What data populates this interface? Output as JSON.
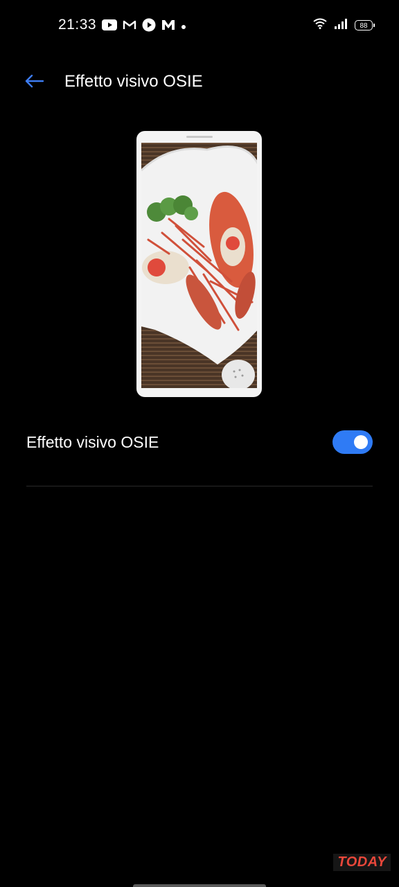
{
  "status_bar": {
    "time": "21:33",
    "battery": "88",
    "notification_icons": [
      "youtube-icon",
      "gmail-icon",
      "play-icon",
      "app-m-icon",
      "dot-icon"
    ],
    "system_icons": [
      "wifi-icon",
      "signal-icon",
      "battery-icon"
    ]
  },
  "header": {
    "back_icon": "arrow-left-icon",
    "title": "Effetto visivo OSIE"
  },
  "preview": {
    "image": "lobster-dish-preview"
  },
  "setting": {
    "label": "Effetto visivo OSIE",
    "enabled": true
  },
  "watermark": {
    "text": "TODAY"
  },
  "colors": {
    "background": "#000000",
    "accent": "#2f7bf5",
    "back_arrow": "#3d7cf2",
    "divider": "#2a2a2a",
    "watermark": "#e8473a"
  }
}
